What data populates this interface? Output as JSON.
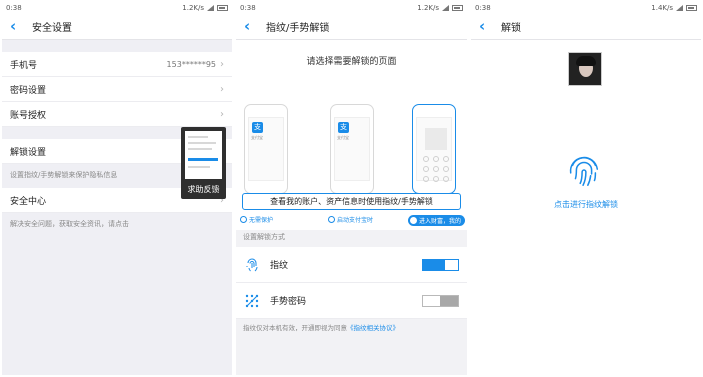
{
  "panels": [
    {
      "status": {
        "time": "0:38",
        "net": "1.2K/s"
      },
      "title": "安全设置",
      "phone": {
        "label": "手机号",
        "value": "153******95"
      },
      "rows": [
        "密码设置",
        "账号授权"
      ],
      "unlock": {
        "label": "解锁设置",
        "hint": "设置指纹/手势解锁来保护隐私信息"
      },
      "security": {
        "label": "安全中心",
        "hint": "解决安全问题，获取安全资讯，请点击"
      },
      "feedback_popup": "求助反馈"
    },
    {
      "status": {
        "time": "0:38",
        "net": "1.2K/s"
      },
      "title": "指纹/手势解锁",
      "choose_heading": "请选择需要解锁的页面",
      "app_icon_glyph": "支",
      "app_name": "支付宝",
      "options": [
        "无需保护",
        "启动支付宝时",
        "进入财富，我的"
      ],
      "selected_option": 2,
      "view_button": "查看我的账户、资产信息时使用指纹/手势解锁",
      "section_title": "设置解锁方式",
      "methods": [
        {
          "label": "指纹",
          "icon": "fingerprint-icon",
          "enabled": true
        },
        {
          "label": "手势密码",
          "icon": "gesture-icon",
          "enabled": false
        }
      ],
      "footer_prefix": "指纹仅对本机有效，开通即视为同意",
      "footer_link": "《指纹相关协议》"
    },
    {
      "status": {
        "time": "0:38",
        "net": "1.4K/s"
      },
      "title": "解锁",
      "unlock_text": "点击进行指纹解锁"
    }
  ],
  "colors": {
    "accent": "#1a8ce8",
    "background": "#efeff4"
  }
}
